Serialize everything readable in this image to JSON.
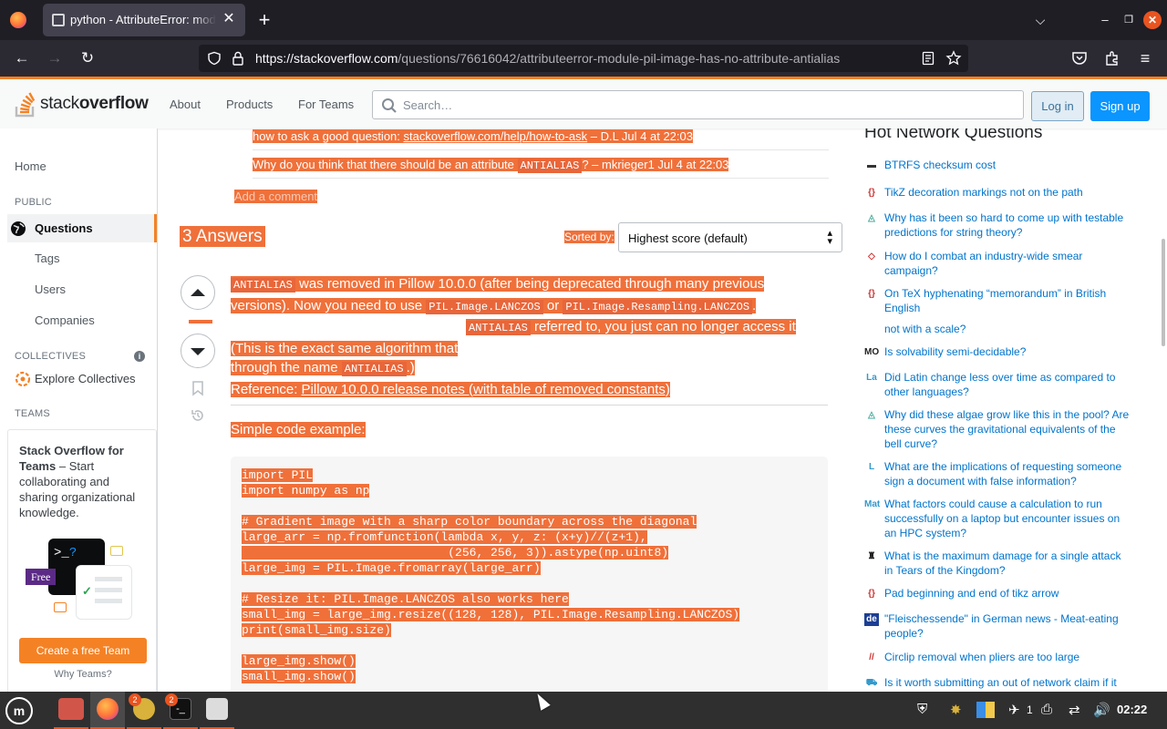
{
  "browser": {
    "tab_title": "python - AttributeError: module 'PIL.Image' has no attribute 'ANTIALIAS'",
    "url_domain": "https://stackoverflow.com",
    "url_path": "/questions/76616042/attributeerror-module-pil-image-has-no-attribute-antialias"
  },
  "header": {
    "logo_stack": "stack",
    "logo_overflow": "overflow",
    "nav": [
      "About",
      "Products",
      "For Teams"
    ],
    "search_placeholder": "Search…",
    "login": "Log in",
    "signup": "Sign up"
  },
  "sidebar": {
    "home": "Home",
    "public": "PUBLIC",
    "questions": "Questions",
    "tags": "Tags",
    "users": "Users",
    "companies": "Companies",
    "collectives": "COLLECTIVES",
    "explore": "Explore Collectives",
    "teams": "TEAMS",
    "teams_box_bold": "Stack Overflow for Teams",
    "teams_box_text": " – Start collaborating and sharing organizational knowledge.",
    "free_tag": "Free",
    "create_team": "Create a free Team",
    "why_teams": "Why Teams?"
  },
  "comments": [
    {
      "text": "how to ask a good question: ",
      "link": "stackoverflow.com/help/how-to-ask",
      "meta": " – D.L Jul 4 at 22:03"
    },
    {
      "text": "Why do you think that there should be an attribute ",
      "code": "ANTIALIAS",
      "meta": "? – mkrieger1 Jul 4 at 22:03"
    }
  ],
  "add_comment": "Add a comment",
  "answers": {
    "count_label": "3 Answers",
    "sorted_by": "Sorted by:",
    "sort_value": "Highest score (default)"
  },
  "answer": {
    "l1_code": "ANTIALIAS",
    "l1_text": " was removed in Pillow 10.0.0 (after being deprecated through many previous",
    "l2_text": "versions). Now you need to use ",
    "l2_code1": "PIL.Image.LANCZOS",
    "l2_or": " or ",
    "l2_code2": "PIL.Image.Resampling.LANCZOS",
    "l2_end": ".",
    "l3_code": "ANTIALIAS",
    "l3_text": " referred to, you just can no longer access it",
    "l4_text": "(This is the exact same algorithm that ",
    "l5_text": "through the name ",
    "l5_code": "ANTIALIAS",
    "l5_end": ".)",
    "ref_label": "Reference: ",
    "ref_link": "Pillow 10.0.0 release notes (with table of removed constants)"
  },
  "simple_code_label": "Simple code example:",
  "code_lines": [
    "import PIL",
    "import numpy as np",
    "",
    "# Gradient image with a sharp color boundary across the diagonal",
    "large_arr = np.fromfunction(lambda x, y, z: (x+y)//(z+1),",
    "                             (256, 256, 3)).astype(np.uint8)",
    "large_img = PIL.Image.fromarray(large_arr)",
    "",
    "# Resize it: PIL.Image.LANCZOS also works here",
    "small_img = large_img.resize((128, 128), PIL.Image.Resampling.LANCZOS)",
    "print(small_img.size)",
    "",
    "large_img.show()",
    "small_img.show()"
  ],
  "hnq": {
    "title": "Hot Network Questions",
    "items": [
      {
        "site": "btrfs",
        "icon": "▬",
        "color": "#333",
        "q": "BTRFS checksum cost"
      },
      {
        "site": "tex",
        "icon": "{}",
        "color": "#c33",
        "q": "TikZ decoration markings not on the path"
      },
      {
        "site": "physics",
        "icon": "◬",
        "color": "#4a9",
        "q": "Why has it been so hard to come up with testable predictions for string theory?"
      },
      {
        "site": "workplace",
        "icon": "◇",
        "color": "#c33",
        "q": "How do I combat an industry-wide smear campaign?"
      },
      {
        "site": "tex",
        "icon": "{}",
        "color": "#c33",
        "q": "On TeX hyphenating “memorandum” in British English"
      },
      {
        "site": "",
        "icon": "",
        "color": "#fff",
        "q": "not with a scale?"
      },
      {
        "site": "mathoverflow",
        "icon": "MO",
        "color": "#222",
        "q": "Is solvability semi-decidable?"
      },
      {
        "site": "latin",
        "icon": "La",
        "color": "#39c",
        "q": "Did Latin change less over time as compared to other languages?"
      },
      {
        "site": "physics",
        "icon": "◬",
        "color": "#4a9",
        "q": "Why did these algae grow like this in the pool? Are these curves the gravitational equivalents of the bell curve?"
      },
      {
        "site": "law",
        "icon": "L",
        "color": "#39c",
        "q": "What are the implications of requesting someone sign a document with false information?"
      },
      {
        "site": "math",
        "icon": "Mat",
        "color": "#39c",
        "q": "What factors could cause a calculation to run successfully on a laptop but encounter issues on an HPC system?"
      },
      {
        "site": "gaming",
        "icon": "♜",
        "color": "#222",
        "q": "What is the maximum damage for a single attack in Tears of the Kingdom?"
      },
      {
        "site": "tex",
        "icon": "{}",
        "color": "#c33",
        "q": "Pad beginning and end of tikz arrow"
      },
      {
        "site": "german",
        "icon": "de",
        "color": "#fff",
        "q": "\"Fleischessende\" in German news - Meat-eating people?"
      },
      {
        "site": "diy",
        "icon": "//",
        "color": "#c33",
        "q": "Circlip removal when pliers are too large"
      },
      {
        "site": "money",
        "icon": "⛟",
        "color": "#39c",
        "q": "Is it worth submitting an out of network claim if it"
      }
    ]
  },
  "taskbar": {
    "badge1": "2",
    "badge2": "2",
    "tray_count": "1",
    "clock": "02:22"
  },
  "colors": {
    "accent": "#f48225",
    "highlight": "#f0703a",
    "link": "#0074cc"
  }
}
